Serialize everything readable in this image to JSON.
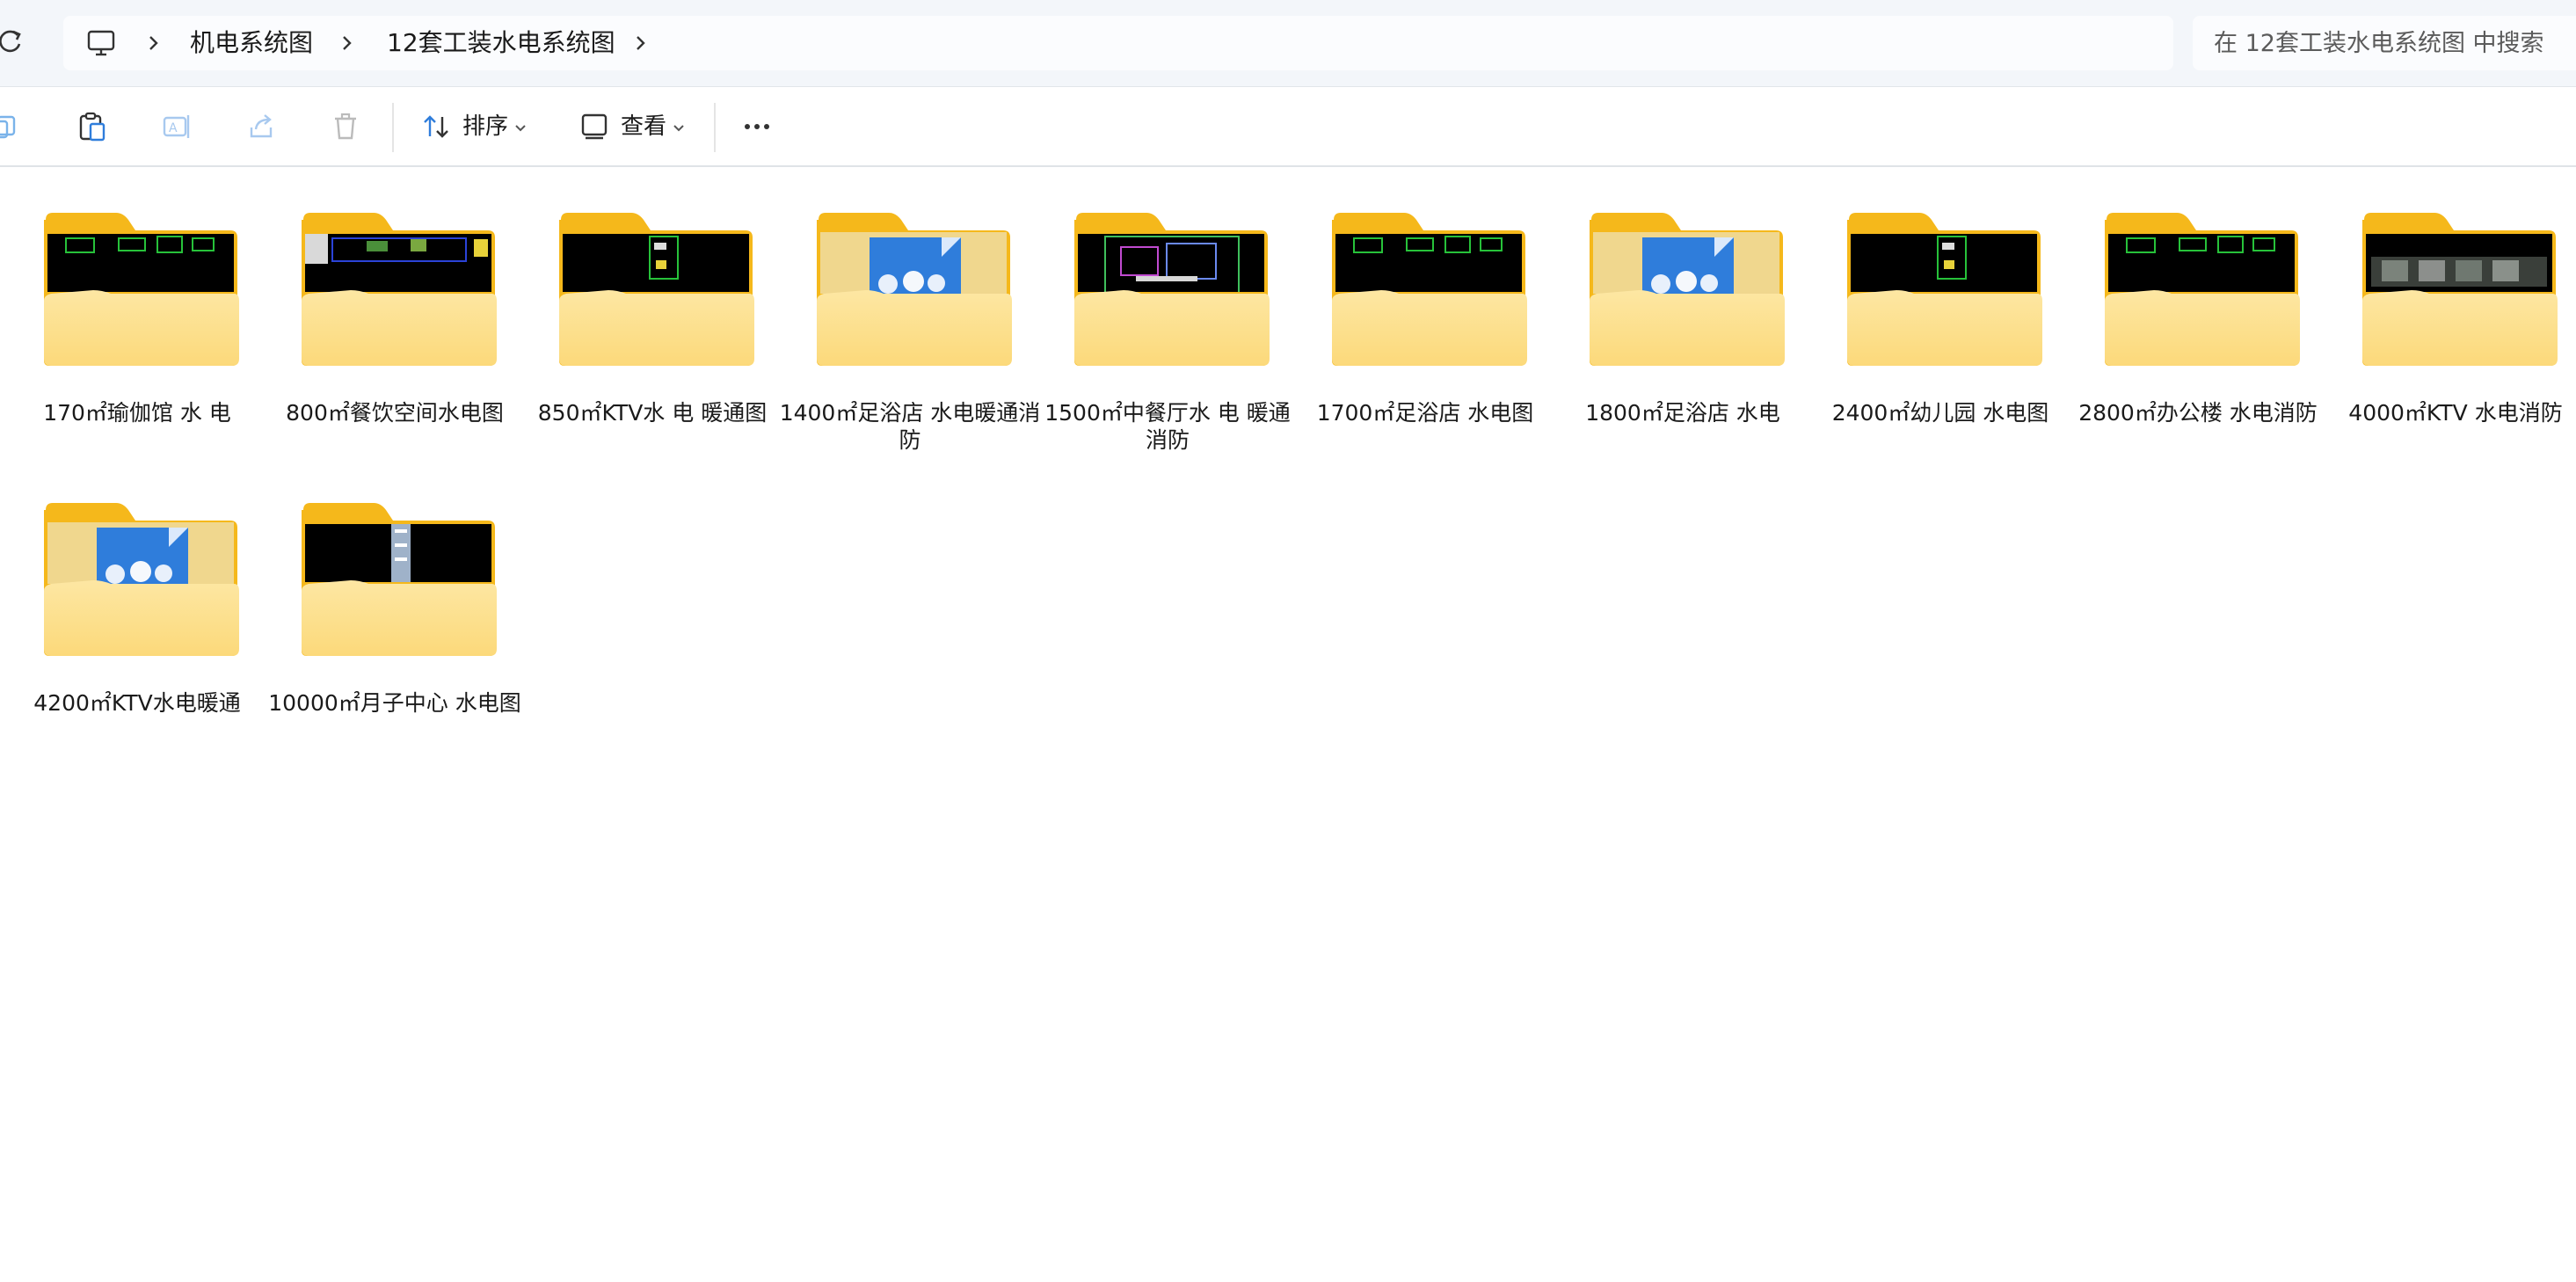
{
  "breadcrumb": {
    "items": [
      "机电系统图",
      "12套工装水电系统图"
    ]
  },
  "search": {
    "placeholder": "在 12套工装水电系统图 中搜索"
  },
  "toolbar": {
    "sort_label": "排序",
    "view_label": "查看"
  },
  "colors": {
    "folder_back": "#f5b81b",
    "folder_front": "#fcd97a",
    "accent_blue": "#2f7ddb"
  },
  "items": [
    {
      "name": "170㎡瑜伽馆 水 电",
      "thumb": "cad-strip"
    },
    {
      "name": "800㎡餐饮空间水电图",
      "thumb": "cad-plan"
    },
    {
      "name": "850㎡KTV水 电 暖通图",
      "thumb": "cad-small"
    },
    {
      "name": "1400㎡足浴店 水电暖通消防",
      "thumb": "file-icon"
    },
    {
      "name": "1500㎡中餐厅水 电 暖通 消防",
      "thumb": "cad-dense"
    },
    {
      "name": "1700㎡足浴店 水电图",
      "thumb": "cad-strip"
    },
    {
      "name": "1800㎡足浴店 水电",
      "thumb": "file-icon"
    },
    {
      "name": "2400㎡幼儿园 水电图",
      "thumb": "cad-small"
    },
    {
      "name": "2800㎡办公楼 水电消防",
      "thumb": "cad-strip"
    },
    {
      "name": "4000㎡KTV 水电消防",
      "thumb": "cad-grey"
    },
    {
      "name": "4200㎡KTV水电暖通",
      "thumb": "file-icon"
    },
    {
      "name": "10000㎡月子中心 水电图",
      "thumb": "cad-tall"
    }
  ]
}
